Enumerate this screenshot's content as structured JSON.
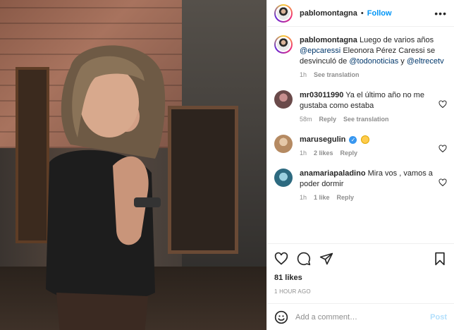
{
  "header": {
    "username": "pablomontagna",
    "separator": "•",
    "follow_label": "Follow",
    "more_label": "•••"
  },
  "caption": {
    "username": "pablomontagna",
    "text_1": "Luego de varios años",
    "mention_1": "@epcaressi",
    "text_2": "Eleonora Pérez Caressi se desvinculó de",
    "mention_2": "@todonoticias",
    "text_3": "y",
    "mention_3": "@eltrecetv",
    "time": "1h",
    "see_translation": "See translation"
  },
  "comments": [
    {
      "username": "mr03011990",
      "text": "Ya el último año no me gustaba como estaba",
      "time": "58m",
      "reply": "Reply",
      "see_translation": "See translation"
    },
    {
      "username": "marusegulin",
      "verified": true,
      "emoji": "worried-face",
      "time": "1h",
      "likes": "2 likes",
      "reply": "Reply"
    },
    {
      "username": "anamariapaladino",
      "text": "Mira vos , vamos a poder dormir",
      "time": "1h",
      "likes": "1 like",
      "reply": "Reply"
    }
  ],
  "actions": {
    "icons": [
      "heart-icon",
      "comment-icon",
      "share-icon",
      "bookmark-icon"
    ],
    "likes": "81 likes",
    "time": "1 HOUR AGO"
  },
  "add_comment": {
    "placeholder": "Add a comment…",
    "post_label": "Post"
  },
  "colors": {
    "link": "#0095f6",
    "mention": "#00376b",
    "muted": "#8e8e8e",
    "post_disabled": "#b2dffc"
  }
}
